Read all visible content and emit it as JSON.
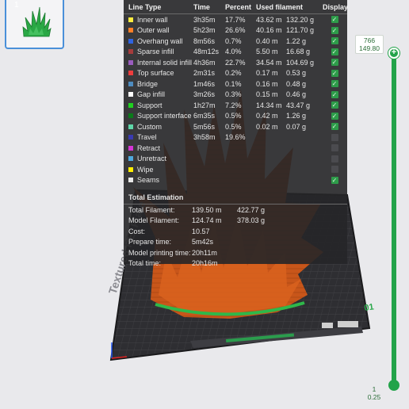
{
  "plate_list": {
    "index": "1"
  },
  "bed": {
    "label": "Textured PEI Plate",
    "corner_label": "01"
  },
  "line_type_table": {
    "headers": {
      "type": "Line Type",
      "time": "Time",
      "percent": "Percent",
      "used": "Used filament",
      "display": "Display"
    },
    "rows": [
      {
        "type": "Inner wall",
        "color": "#ffec3f",
        "time": "3h35m",
        "percent": "17.7%",
        "length": "43.62 m",
        "weight": "132.20 g",
        "display": true
      },
      {
        "type": "Outer wall",
        "color": "#ff7f27",
        "time": "5h23m",
        "percent": "26.6%",
        "length": "40.16 m",
        "weight": "121.70 g",
        "display": true
      },
      {
        "type": "Overhang wall",
        "color": "#2f63e0",
        "time": "8m56s",
        "percent": "0.7%",
        "length": "0.40 m",
        "weight": "1.22 g",
        "display": true
      },
      {
        "type": "Sparse infill",
        "color": "#a63c3c",
        "time": "48m12s",
        "percent": "4.0%",
        "length": "5.50 m",
        "weight": "16.68 g",
        "display": true
      },
      {
        "type": "Internal solid infill",
        "color": "#9a5cbe",
        "time": "4h36m",
        "percent": "22.7%",
        "length": "34.54 m",
        "weight": "104.69 g",
        "display": true
      },
      {
        "type": "Top surface",
        "color": "#ee3d3d",
        "time": "2m31s",
        "percent": "0.2%",
        "length": "0.17 m",
        "weight": "0.53 g",
        "display": true
      },
      {
        "type": "Bridge",
        "color": "#4e8cc0",
        "time": "1m46s",
        "percent": "0.1%",
        "length": "0.16 m",
        "weight": "0.48 g",
        "display": true
      },
      {
        "type": "Gap infill",
        "color": "#ffffff",
        "time": "3m26s",
        "percent": "0.3%",
        "length": "0.15 m",
        "weight": "0.46 g",
        "display": true
      },
      {
        "type": "Support",
        "color": "#20d020",
        "time": "1h27m",
        "percent": "7.2%",
        "length": "14.34 m",
        "weight": "43.47 g",
        "display": true
      },
      {
        "type": "Support interface",
        "color": "#0a7a1a",
        "time": "6m35s",
        "percent": "0.5%",
        "length": "0.42 m",
        "weight": "1.26 g",
        "display": true
      },
      {
        "type": "Custom",
        "color": "#5ed6a8",
        "time": "5m56s",
        "percent": "0.5%",
        "length": "0.02 m",
        "weight": "0.07 g",
        "display": true
      },
      {
        "type": "Travel",
        "color": "#3a3ab0",
        "time": "3h58m",
        "percent": "19.6%",
        "length": "",
        "weight": "",
        "display": false
      },
      {
        "type": "Retract",
        "color": "#d535d5",
        "time": "",
        "percent": "",
        "length": "",
        "weight": "",
        "display": false
      },
      {
        "type": "Unretract",
        "color": "#4fa9de",
        "time": "",
        "percent": "",
        "length": "",
        "weight": "",
        "display": false
      },
      {
        "type": "Wipe",
        "color": "#ffee00",
        "time": "",
        "percent": "",
        "length": "",
        "weight": "",
        "display": false
      },
      {
        "type": "Seams",
        "color": "#e8e8e8",
        "time": "",
        "percent": "",
        "length": "",
        "weight": "",
        "display": true
      }
    ]
  },
  "total_estimation": {
    "title": "Total Estimation",
    "rows": [
      {
        "label": "Total Filament:",
        "v1": "139.50 m",
        "v2": "422.77 g"
      },
      {
        "label": "Model Filament:",
        "v1": "124.74 m",
        "v2": "378.03 g"
      },
      {
        "label": "Cost:",
        "v1": "10.57",
        "v2": ""
      },
      {
        "label": "Prepare time:",
        "v1": "5m42s",
        "v2": ""
      },
      {
        "label": "Model printing time:",
        "v1": "20h11m",
        "v2": ""
      },
      {
        "label": "Total time:",
        "v1": "20h16m",
        "v2": ""
      }
    ]
  },
  "layer_slider": {
    "top_layer": "766",
    "top_height": "149.80",
    "top_handle_symbol": "+",
    "bottom_layer": "1",
    "bottom_height": "0.25"
  }
}
